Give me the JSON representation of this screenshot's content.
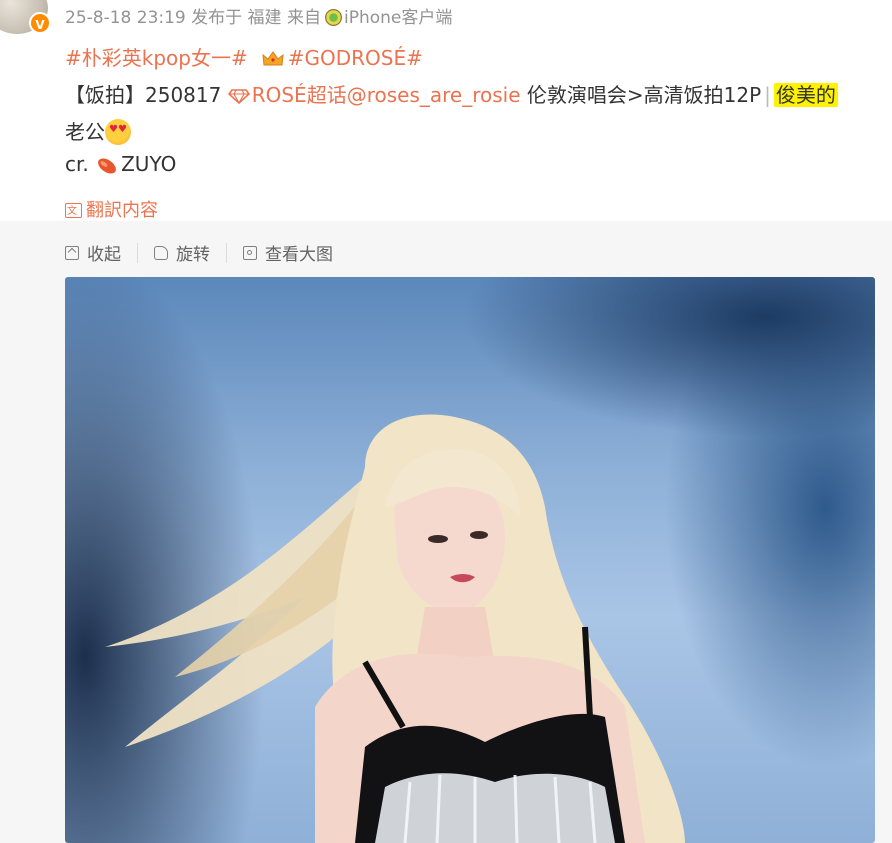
{
  "post": {
    "meta": {
      "time": "25-8-18 23:19",
      "published_at": "发布于 福建",
      "from": "来自",
      "client": "iPhone客户端"
    },
    "topics": {
      "topic1": "#朴彩英kpop女一#",
      "topic2": "#GODROSÉ#"
    },
    "text": {
      "prefix": "【饭拍】250817",
      "supertopic": "ROSÉ超话",
      "mention": "@roses_are_rosie",
      "middle": " 伦敦演唱会>高清饭拍12P",
      "separator": "|",
      "highlight": "俊美的",
      "line3": "老公",
      "credit_prefix": "cr.",
      "credit_name": "ZUYO"
    },
    "translate_label": "翻訳内容"
  },
  "media_toolbar": {
    "collapse": "收起",
    "rotate": "旋转",
    "view_large": "查看大图"
  },
  "icons": {
    "avatar_badge": "v-verified-badge",
    "client": "kiwi-icon",
    "crown": "crown-icon",
    "supertopic": "diamond-icon",
    "emoji": "heart-eyes-emoji",
    "credit": "sweet-potato-icon",
    "translate": "translate-icon",
    "collapse": "collapse-icon",
    "rotate": "rotate-icon",
    "view": "view-large-icon"
  },
  "colors": {
    "link": "#eb7350",
    "meta": "#939393",
    "highlight": "#fff200",
    "panel": "#f6f6f6"
  }
}
